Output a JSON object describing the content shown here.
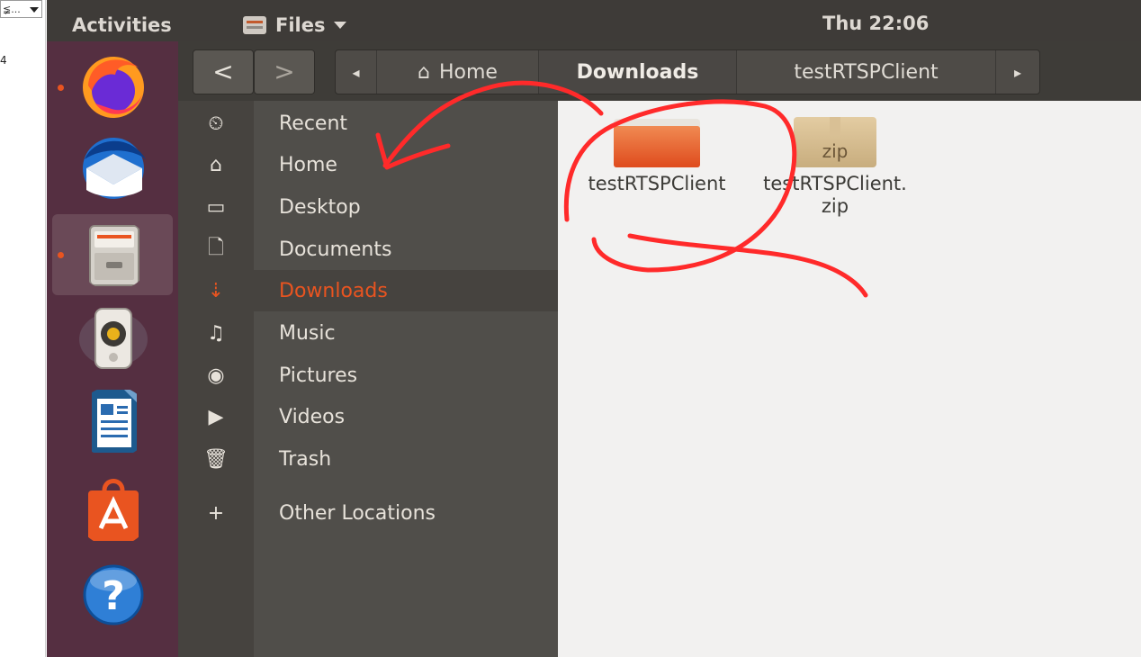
{
  "host": {
    "combo_text": "≨...",
    "side_number": "4"
  },
  "topbar": {
    "activities": "Activities",
    "app_menu": "Files",
    "clock": "Thu 22:06"
  },
  "dock": {
    "items": [
      {
        "name": "firefox-icon"
      },
      {
        "name": "thunderbird-icon"
      },
      {
        "name": "files-icon"
      },
      {
        "name": "rhythmbox-icon"
      },
      {
        "name": "libreoffice-writer-icon"
      },
      {
        "name": "software-center-icon"
      },
      {
        "name": "help-icon"
      }
    ]
  },
  "nav": {
    "back": "<",
    "forward": ">"
  },
  "breadcrumbs": {
    "left_arrow": "◂",
    "home": "Home",
    "current": "Downloads",
    "next": "testRTSPClient",
    "right_arrow": "▸"
  },
  "places": [
    {
      "label": "Recent",
      "icon": "⏲"
    },
    {
      "label": "Home",
      "icon": "⌂"
    },
    {
      "label": "Desktop",
      "icon": "▭"
    },
    {
      "label": "Documents",
      "icon": "🗋"
    },
    {
      "label": "Downloads",
      "icon": "⇣"
    },
    {
      "label": "Music",
      "icon": "♫"
    },
    {
      "label": "Pictures",
      "icon": "◉"
    },
    {
      "label": "Videos",
      "icon": "▶"
    },
    {
      "label": "Trash",
      "icon": "🗑"
    },
    {
      "label": "Other Locations",
      "icon": "+"
    }
  ],
  "files": [
    {
      "name": "testRTSPClient",
      "type": "folder"
    },
    {
      "name": "testRTSPClient.zip",
      "type": "zip",
      "badge": "zip"
    }
  ],
  "colors": {
    "accent": "#e95420",
    "dock": "#552f41",
    "annotation": "#ff2a2a"
  }
}
